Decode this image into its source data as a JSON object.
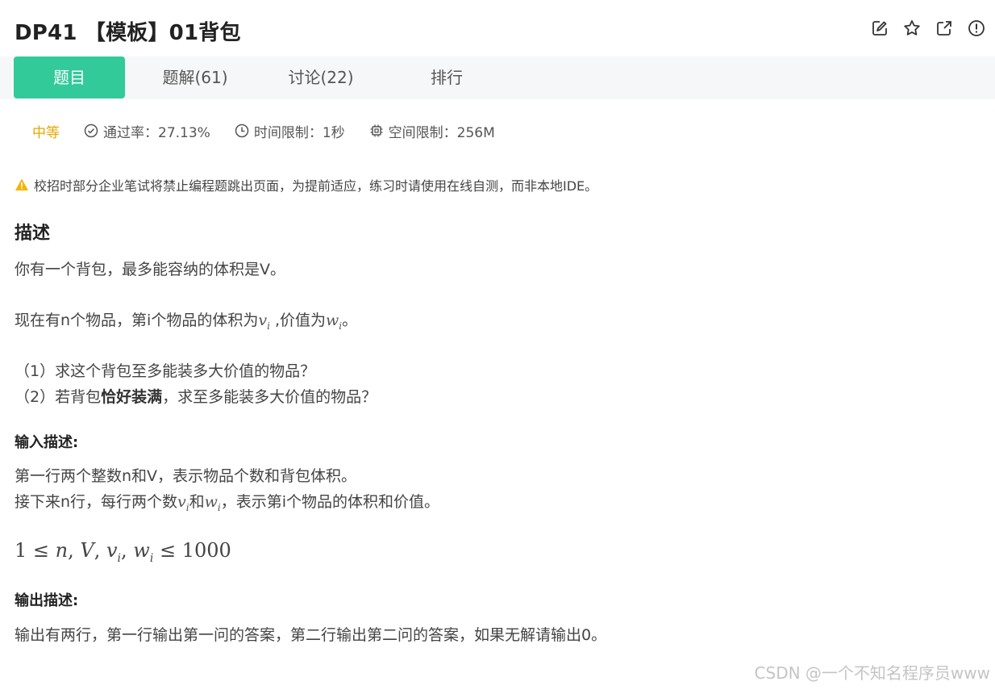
{
  "header": {
    "title": "DP41 【模板】01背包",
    "icons": [
      "edit-icon",
      "star-icon",
      "external-link-icon",
      "info-icon"
    ]
  },
  "tabs": [
    {
      "label": "题目",
      "active": true
    },
    {
      "label": "题解(61)",
      "active": false
    },
    {
      "label": "讨论(22)",
      "active": false
    },
    {
      "label": "排行",
      "active": false
    }
  ],
  "meta": {
    "difficulty": "中等",
    "pass_rate": "通过率：27.13%",
    "time_limit": "时间限制：1秒",
    "space_limit": "空间限制：256M"
  },
  "warning": "校招时部分企业笔试将禁止编程题跳出页面，为提前适应，练习时请使用在线自测，而非本地IDE。",
  "description": {
    "heading": "描述",
    "line1": "你有一个背包，最多能容纳的体积是V。",
    "line2_a": "现在有n个物品，第i个物品的体积为",
    "line2_b": " ,价值为",
    "line2_c": "。",
    "q1": "（1）求这个背包至多能装多大价值的物品？",
    "q2_a": "（2）若背包",
    "q2_bold": "恰好装满",
    "q2_b": "，求至多能装多大价值的物品？"
  },
  "input": {
    "heading": "输入描述:",
    "line1": "第一行两个整数n和V，表示物品个数和背包体积。",
    "line2_a": "接下来n行，每行两个数",
    "line2_b": "和",
    "line2_c": "，表示第i个物品的体积和价值。"
  },
  "output": {
    "heading": "输出描述:",
    "line1": "输出有两行，第一行输出第一问的答案，第二行输出第二问的答案，如果无解请输出0。"
  },
  "watermark": "CSDN @一个不知名程序员www",
  "colors": {
    "accent": "#32ca99",
    "difficulty": "#e6a700",
    "warning": "#f5b400",
    "tabbar_bg": "#f6f7f9"
  }
}
